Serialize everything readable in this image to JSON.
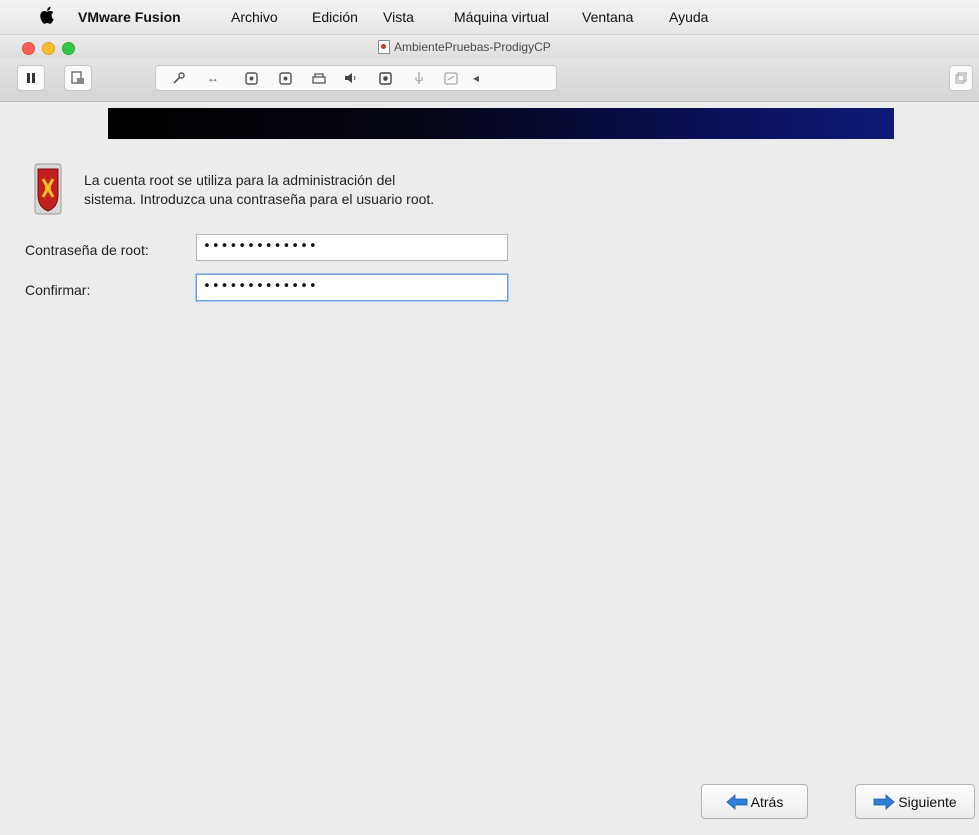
{
  "menubar": {
    "app_name": "VMware Fusion",
    "items": [
      "Archivo",
      "Edición",
      "Vista",
      "Máquina virtual",
      "Ventana",
      "Ayuda"
    ]
  },
  "window": {
    "title": "AmbientePruebas-ProdigyCP"
  },
  "toolbar": {
    "left_buttons": [
      "pause-icon",
      "snapshot-icon"
    ],
    "strip_icons": [
      "wrench-icon",
      "resize-arrows-icon",
      "hard-disk-icon",
      "hard-disk-2-icon",
      "printer-icon",
      "speaker-icon",
      "camera-icon",
      "usb-icon",
      "share-icon",
      "chevron-left-icon"
    ],
    "right_button": "fullscreen-icon"
  },
  "installer": {
    "intro_line1": "La cuenta root se utiliza para la administración del",
    "intro_line2": "sistema. Introduzca una contraseña para el usuario root.",
    "root_password_label": "Contraseña de root:",
    "root_password_value": "•••••••••••••",
    "confirm_label": "Confirmar:",
    "confirm_value": "•••••••••••••",
    "back_label": "Atrás",
    "next_label": "Siguiente"
  },
  "colors": {
    "banner_start": "#000000",
    "banner_end": "#0f1a78",
    "focus_ring": "#6f9fd6",
    "arrow_blue": "#2f7fd8"
  }
}
